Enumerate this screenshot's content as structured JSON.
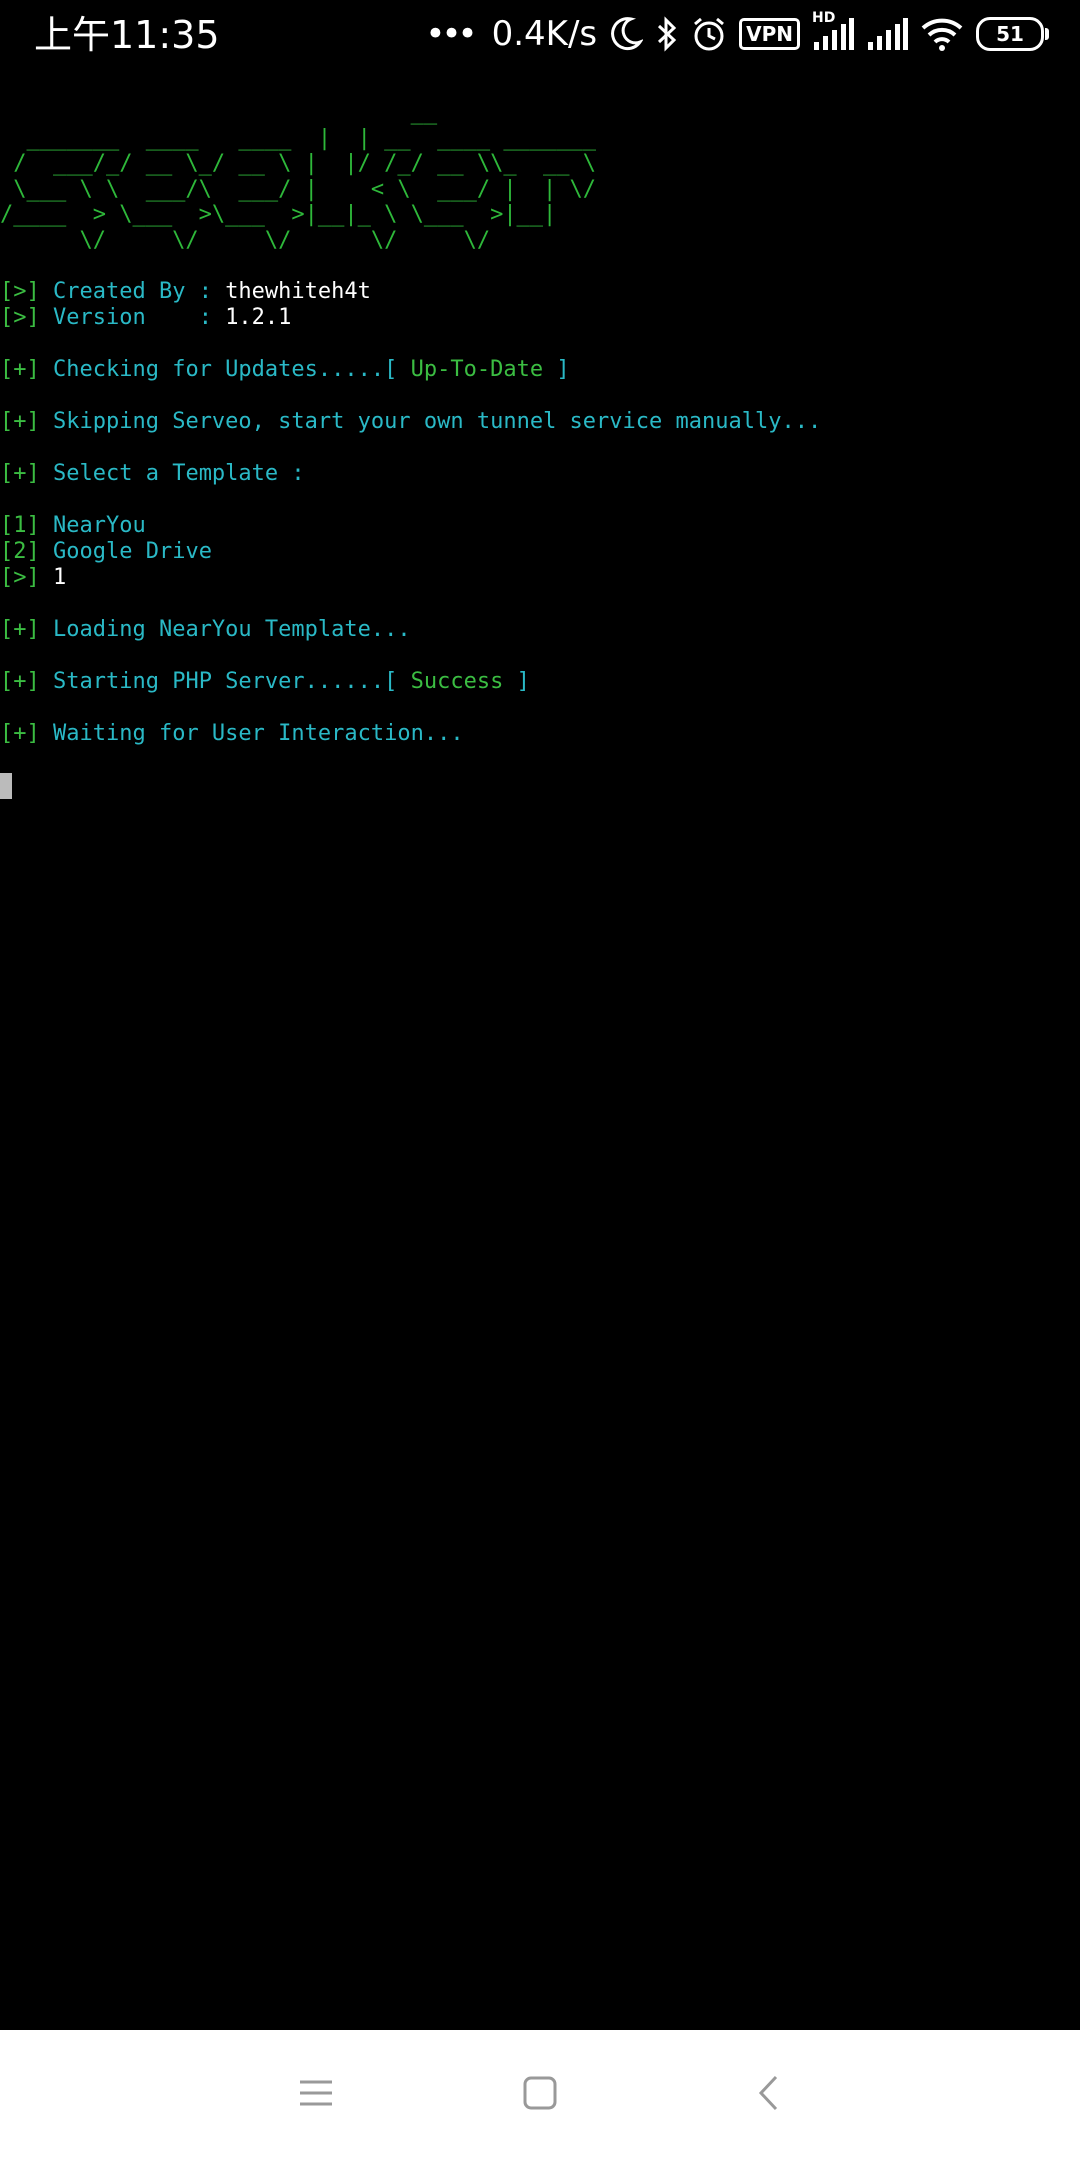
{
  "status_bar": {
    "time": "上午11:35",
    "net_speed": "0.4K/s",
    "vpn_label": "VPN",
    "hd_label": "HD",
    "battery": "51",
    "icons": [
      "more-dots-icon",
      "moon-icon",
      "bluetooth-icon",
      "alarm-icon",
      "vpn-icon",
      "signal-hd-icon",
      "signal-icon",
      "wifi-icon",
      "battery-icon"
    ]
  },
  "terminal": {
    "banner": [
      "                               __",
      "  _______  ____   ____  |  | __  ____ _______",
      " /  ___/_/ __ \\_/ __ \\ |  |/ /_/ __ \\\\_  __ \\",
      " \\___ \\ \\  ___/\\  ___/ |    < \\  ___/ |  | \\/",
      "/____  > \\___  >\\___  >|__|_ \\ \\___  >|__|",
      "      \\/     \\/     \\/      \\/     \\/"
    ],
    "created_prefix": "[>]",
    "created_label": " Created By : ",
    "created_value": "thewhiteh4t",
    "version_prefix": "[>]",
    "version_label": " Version    : ",
    "version_value": "1.2.1",
    "updates_prefix": "[+]",
    "updates_label": " Checking for Updates.....[ ",
    "updates_status": "Up-To-Date",
    "updates_close": " ]",
    "serveo_prefix": "[+]",
    "serveo_text": " Skipping Serveo, start your own tunnel service manually...",
    "select_prefix": "[+]",
    "select_text": " Select a Template :",
    "option1_num": "[1]",
    "option1_label": " NearYou",
    "option2_num": "[2]",
    "option2_label": " Google Drive",
    "input_prefix": "[>]",
    "input_value": " 1",
    "loading_prefix": "[+]",
    "loading_text": " Loading NearYou Template...",
    "php_prefix": "[+]",
    "php_label": " Starting PHP Server......[ ",
    "php_status": "Success",
    "php_close": " ]",
    "waiting_prefix": "[+]",
    "waiting_text": " Waiting for User Interaction..."
  },
  "colors": {
    "background": "#000000",
    "green": "#3bbd42",
    "cyan": "#2ab9c6",
    "white": "#ffffff"
  },
  "nav_bar": {
    "icons": [
      "menu-icon",
      "home-icon",
      "back-icon"
    ]
  }
}
